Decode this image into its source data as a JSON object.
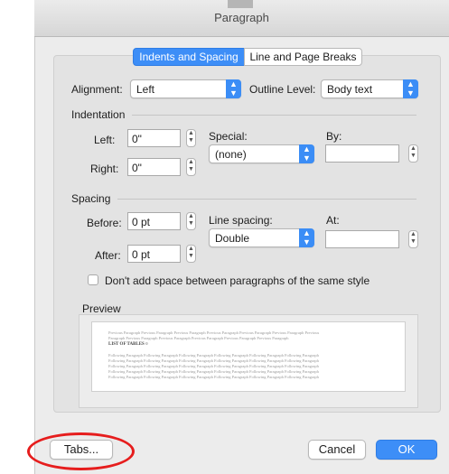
{
  "window": {
    "title": "Paragraph"
  },
  "tabs": [
    {
      "label": "Indents and Spacing",
      "active": true
    },
    {
      "label": "Line and Page Breaks",
      "active": false
    }
  ],
  "alignment": {
    "label": "Alignment:",
    "value": "Left"
  },
  "outline_level": {
    "label": "Outline Level:",
    "value": "Body text"
  },
  "indentation": {
    "heading": "Indentation",
    "left": {
      "label": "Left:",
      "value": "0\""
    },
    "right": {
      "label": "Right:",
      "value": "0\""
    },
    "special": {
      "label": "Special:",
      "value": "(none)"
    },
    "by": {
      "label": "By:",
      "value": ""
    }
  },
  "spacing": {
    "heading": "Spacing",
    "before": {
      "label": "Before:",
      "value": "0 pt"
    },
    "after": {
      "label": "After:",
      "value": "0 pt"
    },
    "line_spacing": {
      "label": "Line spacing:",
      "value": "Double"
    },
    "at": {
      "label": "At:",
      "value": ""
    }
  },
  "dont_add_space": {
    "label": "Don't add space between paragraphs of the same style",
    "checked": false
  },
  "preview": {
    "heading": "Preview",
    "prev_line1": "Previous Paragraph Previous Paragraph Previous Paragraph Previous Paragraph Previous Paragraph Previous Paragraph Previous",
    "prev_line2": "Paragraph Previous Paragraph Previous Paragraph Previous Paragraph Previous Paragraph Previous Paragraph",
    "sample": "LIST OF TABLES  ¤",
    "follow_line": "Following Paragraph Following Paragraph Following Paragraph Following Paragraph Following Paragraph Following Paragraph"
  },
  "buttons": {
    "tabs": "Tabs...",
    "cancel": "Cancel",
    "ok": "OK"
  },
  "colors": {
    "accent": "#3d8ef7",
    "highlight_circle": "#e61d1d"
  },
  "icons": {
    "popup_arrow": "chevron-updown-icon",
    "stepper": "stepper-icon"
  }
}
